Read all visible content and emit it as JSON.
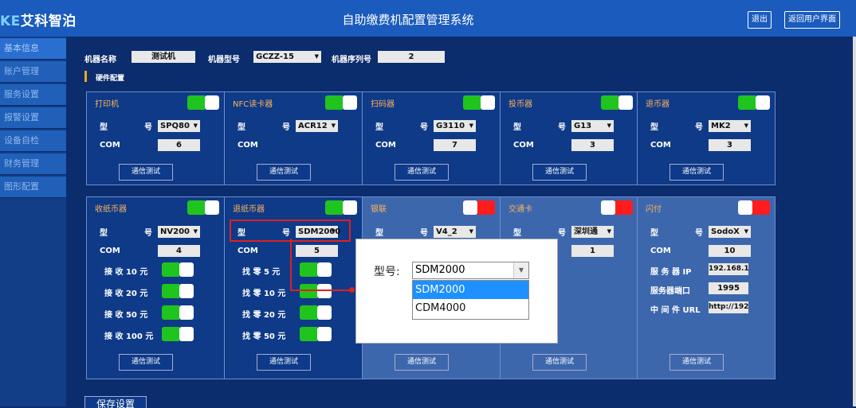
{
  "header": {
    "logo_prefix": "KE",
    "logo_text": "艾科智泊",
    "title": "自助缴费机配置管理系统",
    "logout": "退出",
    "back": "返回用户界面"
  },
  "sidebar": {
    "items": [
      {
        "label": "基本信息"
      },
      {
        "label": "账户管理"
      },
      {
        "label": "服务设置"
      },
      {
        "label": "报警设置"
      },
      {
        "label": "设备自检"
      },
      {
        "label": "财务管理"
      },
      {
        "label": "图形配置"
      }
    ]
  },
  "info": {
    "name_label": "机器名称",
    "name_value": "测试机",
    "model_label": "机器型号",
    "model_value": "GCZZ-15",
    "serial_label": "机器序列号",
    "serial_value": "2",
    "section_title": "硬件配置"
  },
  "labels": {
    "type_a": "型",
    "type_b": "号",
    "com": "COM",
    "test": "通信测试",
    "test_dim": "通信测试"
  },
  "row1": [
    {
      "title": "打印机",
      "enabled": true,
      "model": "SPQ80",
      "com": "6"
    },
    {
      "title": "NFC读卡器",
      "enabled": true,
      "model": "ACR12",
      "com": ""
    },
    {
      "title": "扫码器",
      "enabled": true,
      "model": "G3110",
      "com": "7"
    },
    {
      "title": "投币器",
      "enabled": true,
      "model": "G13",
      "com": "3"
    },
    {
      "title": "退币器",
      "enabled": true,
      "model": "MK2",
      "com": "3"
    }
  ],
  "row2": [
    {
      "title": "收纸币器",
      "enabled": true,
      "model": "NV200",
      "com": "4",
      "rows": [
        "接 收 10 元",
        "接 收 20 元",
        "接 收 50 元",
        "接 收 100 元"
      ]
    },
    {
      "title": "退纸币器",
      "enabled": true,
      "model": "SDM2000",
      "com": "5",
      "rows": [
        "找 零 5 元",
        "找 零 10 元",
        "找 零 20 元",
        "找 零 50 元"
      ]
    },
    {
      "title": "银联",
      "enabled": false,
      "model": "V4_2",
      "com": ""
    },
    {
      "title": "交通卡",
      "enabled": false,
      "model": "深圳通",
      "com": "1"
    },
    {
      "title": "闪付",
      "enabled": false,
      "model": "SodoX",
      "com": "10",
      "ip_label": "服 务 器 IP",
      "ip": "192.168.1.",
      "port_label": "服务器端口",
      "port": "1995",
      "url_label": "中 间 件 URL",
      "url": "http://192."
    }
  ],
  "popup": {
    "label": "型号:",
    "value": "SDM2000",
    "options": [
      "SDM2000",
      "CDM4000"
    ]
  },
  "save": "保存设置",
  "colors": {
    "accent": "#1fc41f",
    "off": "#ff1c1c",
    "header": "#1a5bbd",
    "highlight": "#e02020"
  }
}
